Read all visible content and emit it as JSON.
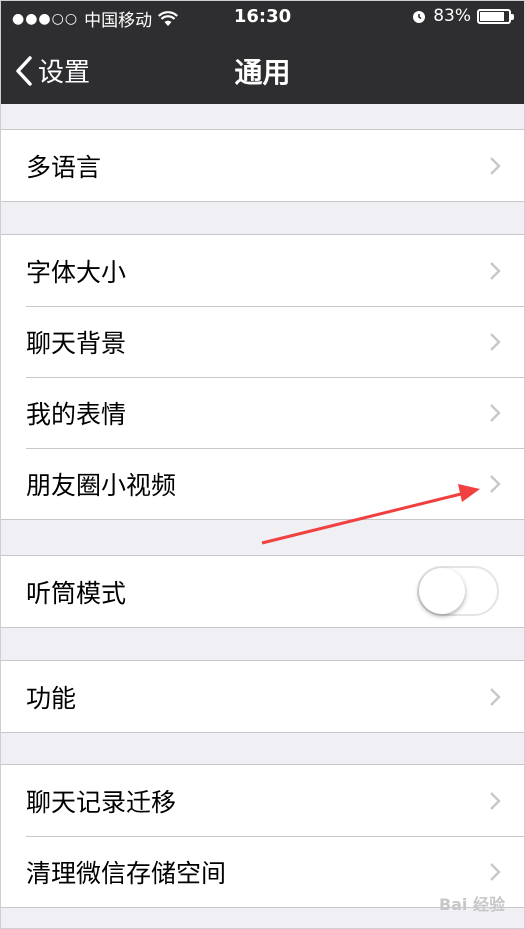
{
  "status_bar": {
    "carrier": "中国移动",
    "time": "16:30",
    "battery": "83%",
    "battery_level": 0.83,
    "icons": [
      "signal-dots-icon",
      "wifi-icon",
      "alarm-icon",
      "battery-icon"
    ]
  },
  "nav": {
    "back_label": "设置",
    "title": "通用"
  },
  "groups": {
    "g1": {
      "items": [
        {
          "label": "多语言"
        }
      ]
    },
    "g2": {
      "items": [
        {
          "label": "字体大小"
        },
        {
          "label": "聊天背景"
        },
        {
          "label": "我的表情"
        },
        {
          "label": "朋友圈小视频"
        }
      ]
    },
    "g3": {
      "items": [
        {
          "label": "听筒模式",
          "toggle": false
        }
      ]
    },
    "g4": {
      "items": [
        {
          "label": "功能"
        }
      ]
    },
    "g5": {
      "items": [
        {
          "label": "聊天记录迁移"
        },
        {
          "label": "清理微信存储空间"
        }
      ]
    }
  },
  "annotation": {
    "type": "red-arrow",
    "color": "#f04040"
  },
  "watermark": "Bai 经验",
  "colors": {
    "nav_bg": "#2e2e30",
    "page_bg": "#efeff4",
    "separator": "#c8c7cc",
    "chevron": "#c7c7cc"
  }
}
